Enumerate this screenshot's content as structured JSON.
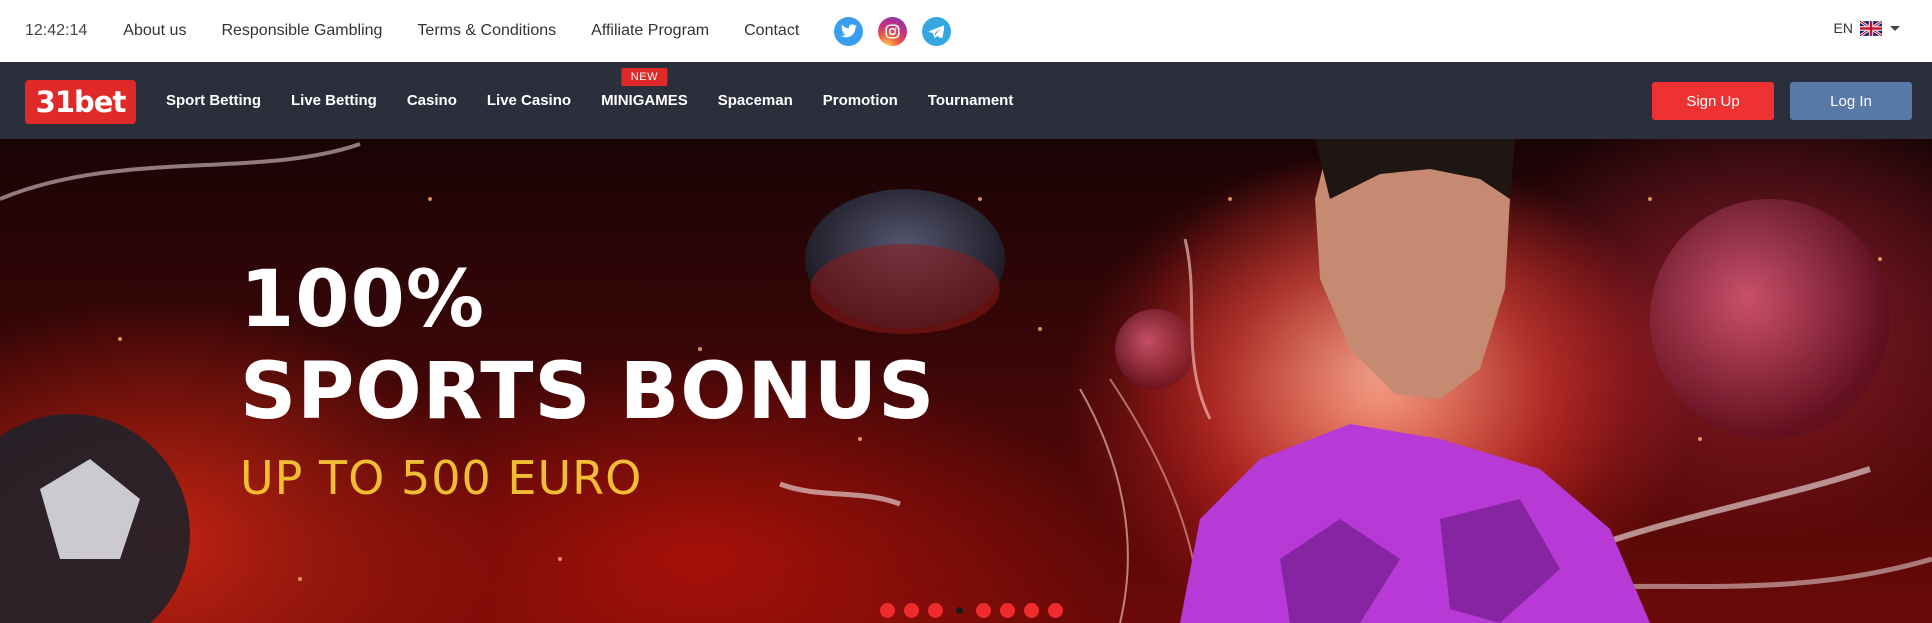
{
  "topbar": {
    "clock": "12:42:14",
    "links": [
      "About us",
      "Responsible Gambling",
      "Terms & Conditions",
      "Affiliate Program",
      "Contact"
    ],
    "social": [
      {
        "name": "twitter-icon",
        "color": "#3a9ef0"
      },
      {
        "name": "instagram-icon",
        "color": "#c8307e"
      },
      {
        "name": "telegram-icon",
        "color": "#34a6e0"
      }
    ],
    "language": "EN",
    "language_flag": "uk-flag-icon"
  },
  "navbar": {
    "logo": "31bet",
    "items": [
      {
        "label": "Sport Betting"
      },
      {
        "label": "Live Betting"
      },
      {
        "label": "Casino"
      },
      {
        "label": "Live Casino"
      },
      {
        "label": "MINIGAMES",
        "badge": "NEW"
      },
      {
        "label": "Spaceman"
      },
      {
        "label": "Promotion"
      },
      {
        "label": "Tournament"
      }
    ],
    "signup_label": "Sign Up",
    "login_label": "Log In"
  },
  "hero": {
    "headline_line1": "100%",
    "headline_line2": "SPORTS BONUS",
    "subheadline": "UP TO 500 EURO",
    "slide_count": 8,
    "active_slide": 3
  },
  "colors": {
    "brand_red": "#e02a2a",
    "nav_bg": "#2b2e3b",
    "login_blue": "#5878a6",
    "bonus_gold": "#f1bd32"
  }
}
